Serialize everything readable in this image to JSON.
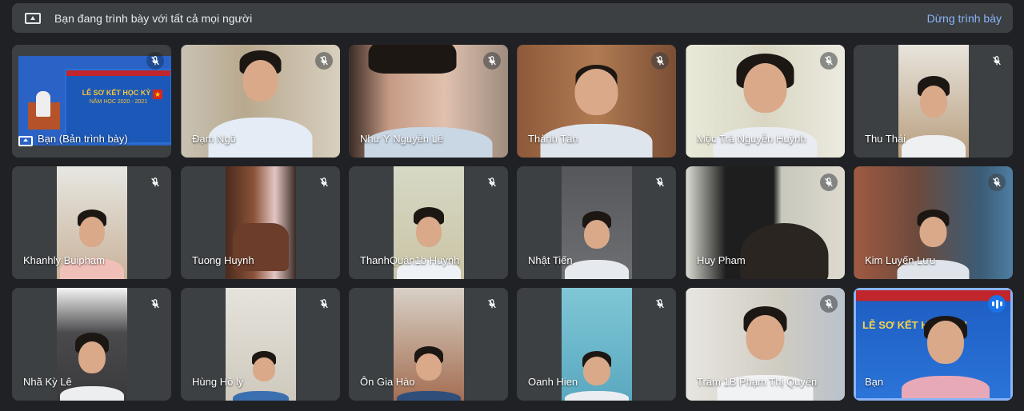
{
  "banner": {
    "text": "Bạn đang trình bày với tất cả mọi người",
    "stop_label": "Dừng trình bày"
  },
  "tiles": [
    {
      "name": "Bạn (Bản trình bày)"
    },
    {
      "name": "Đạm Ngô"
    },
    {
      "name": "Như Ý Nguyễn Lê"
    },
    {
      "name": "Thành Tân"
    },
    {
      "name": "Mộc Trà Nguyễn Huỳnh"
    },
    {
      "name": "Thu Thái"
    },
    {
      "name": "Khanhly Buipham"
    },
    {
      "name": "Tuong Huynh"
    },
    {
      "name": "ThanhQuân1b Huỳnh"
    },
    {
      "name": "Nhật Tiến"
    },
    {
      "name": "Huy Pham"
    },
    {
      "name": "Kim Luyến Lưu"
    },
    {
      "name": "Nhã Kỳ Lê"
    },
    {
      "name": "Hùng Hồ lý"
    },
    {
      "name": "Ôn Gia Hào"
    },
    {
      "name": "Oanh Hien"
    },
    {
      "name": "Trâm 1B Phạm Thị Quyên"
    },
    {
      "name": "Bạn"
    }
  ],
  "slide": {
    "title": "LỄ SƠ KẾT HỌC KỲ I",
    "subtitle": "NĂM HỌC 2020 - 2021"
  },
  "colors": {
    "background": "#202124",
    "tile": "#3c4043",
    "accent": "#8ab4f8",
    "speaking": "#1a73e8"
  }
}
